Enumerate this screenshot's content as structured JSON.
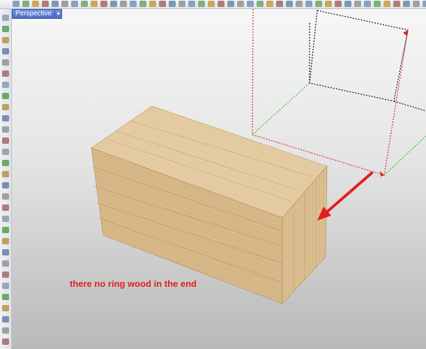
{
  "viewport": {
    "tab_label": "Perspective",
    "tab_menu_icon": "chevron-down-icon"
  },
  "annotation": {
    "text": "there no ring wood in the end",
    "color": "#e02020"
  },
  "colors": {
    "wood_light": "#e3c79c",
    "wood_mid": "#d3b385",
    "wood_dark": "#c4a272",
    "axis_red": "#e02020",
    "axis_green": "#22cc22",
    "tab_blue": "#4a6fc7"
  },
  "icons": {
    "top_toolbar": [
      "toolbar-icon",
      "toolbar-icon",
      "toolbar-icon"
    ],
    "left_toolbar": [
      "tool-icon"
    ]
  }
}
